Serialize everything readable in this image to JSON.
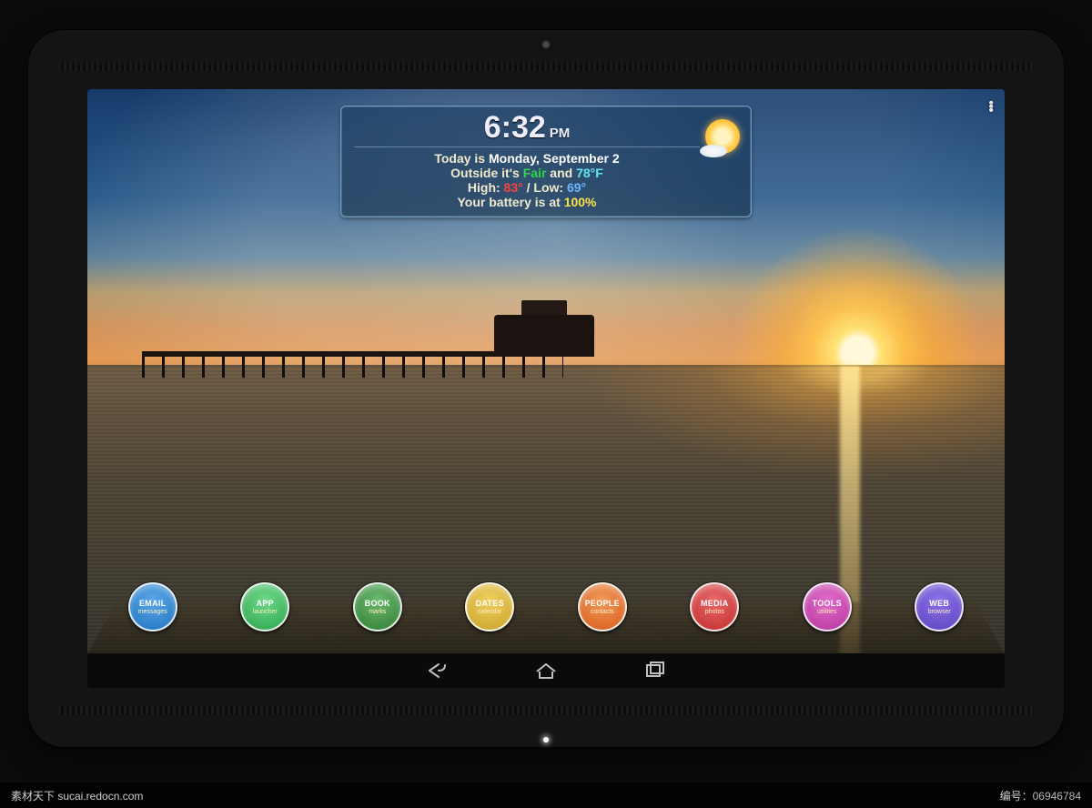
{
  "widget": {
    "time": "6:32",
    "ampm": "PM",
    "today_prefix": "Today is ",
    "today_value": "Monday, September 2",
    "outside_prefix": "Outside it's ",
    "condition": "Fair",
    "and": " and ",
    "temp": "78°F",
    "high_label": "High:  ",
    "high_value": "83°",
    "sep": " /  ",
    "low_label": "Low:  ",
    "low_value": "69°",
    "battery_prefix": "Your battery is at ",
    "battery_value": "100%"
  },
  "dock": {
    "items": [
      {
        "title": "EMAIL",
        "subtitle": "messages",
        "color": "#1e73be"
      },
      {
        "title": "APP",
        "subtitle": "launcher",
        "color": "#2aa34a"
      },
      {
        "title": "BOOK",
        "subtitle": "marks",
        "color": "#2e7d32"
      },
      {
        "title": "DATES",
        "subtitle": "calendar",
        "color": "#c9a227"
      },
      {
        "title": "PEOPLE",
        "subtitle": "contacts",
        "color": "#d85a1a"
      },
      {
        "title": "MEDIA",
        "subtitle": "photos",
        "color": "#c22b2b"
      },
      {
        "title": "TOOLS",
        "subtitle": "utilities",
        "color": "#b6359c"
      },
      {
        "title": "WEB",
        "subtitle": "browser",
        "color": "#5a3fbf"
      }
    ]
  },
  "stock": {
    "site_label": "素材天下  sucai.redocn.com",
    "id_label": "编号：",
    "id_value": "06946784"
  }
}
